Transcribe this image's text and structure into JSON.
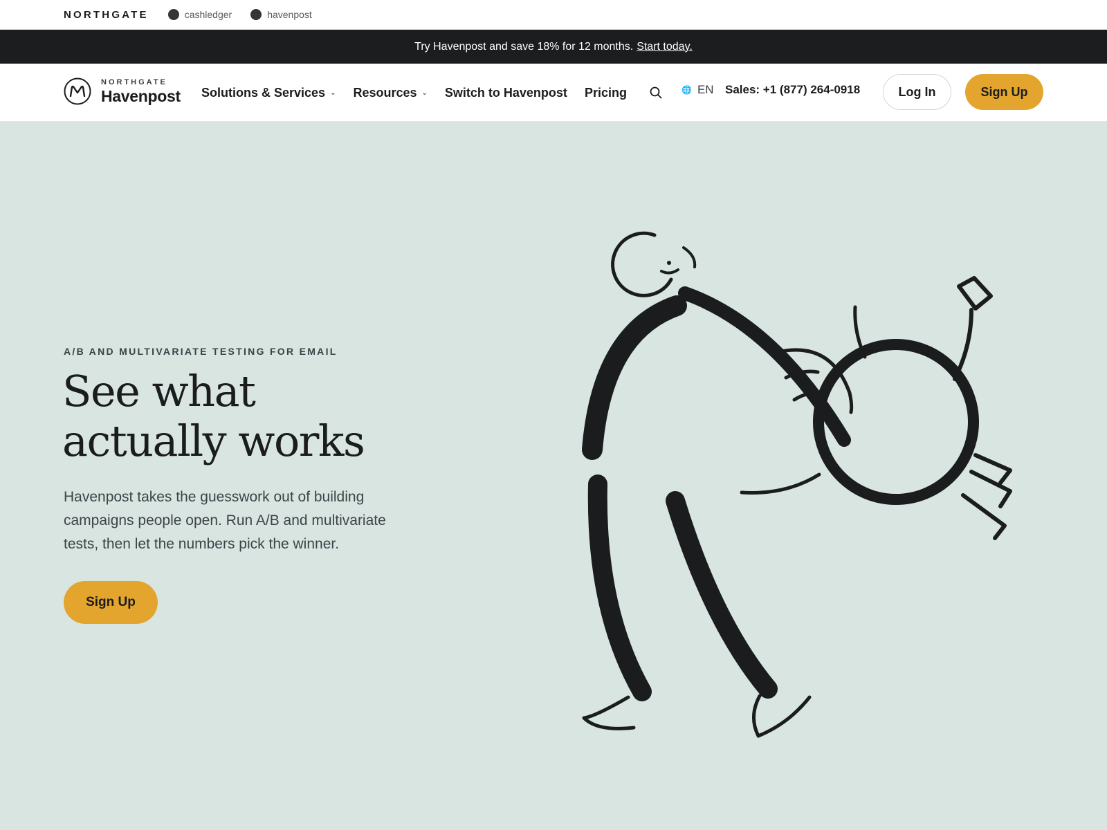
{
  "brandbar": {
    "parent": "NORTHGATE",
    "subbrands": [
      "cashledger",
      "havenpost"
    ]
  },
  "promo": {
    "text": "Try Havenpost and save 18% for 12 months.",
    "link": "Start today."
  },
  "nav": {
    "logo_small": "NORTHGATE",
    "logo_big": "Havenpost",
    "items": [
      {
        "label": "Solutions & Services",
        "has_dropdown": true
      },
      {
        "label": "Resources",
        "has_dropdown": true
      },
      {
        "label": "Switch to Havenpost",
        "has_dropdown": false
      },
      {
        "label": "Pricing",
        "has_dropdown": false
      }
    ],
    "language": "EN",
    "sales": "Sales: +1 (877) 264-0918",
    "login_label": "Log In",
    "signup_label": "Sign Up"
  },
  "hero": {
    "eyebrow": "A/B AND MULTIVARIATE TESTING FOR EMAIL",
    "headline_line1": "See what",
    "headline_line2": "actually works",
    "lead": "Havenpost takes the guesswork out of building campaigns people open. Run A/B and multivariate tests, then let the numbers pick the winner.",
    "cta_label": "Sign Up"
  },
  "colors": {
    "accent": "#e3a52e",
    "hero_background": "#d9e5e1",
    "promo_background": "#1c1d1f",
    "ink": "#1a1c1e"
  }
}
